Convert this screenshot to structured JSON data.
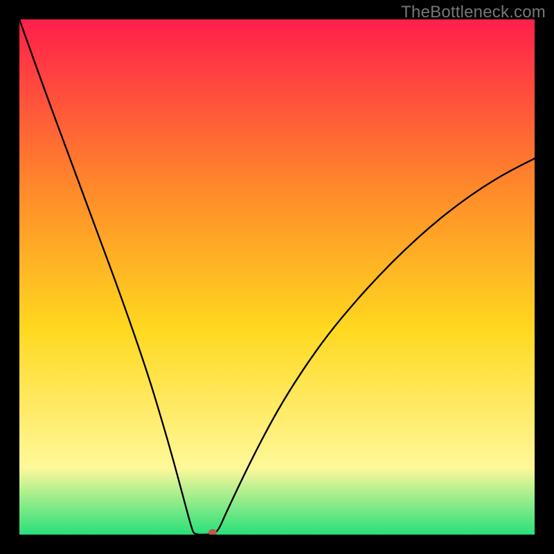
{
  "watermark": "TheBottleneck.com",
  "chart_data": {
    "type": "line",
    "title": "",
    "xlabel": "",
    "ylabel": "",
    "ylim": [
      0,
      100
    ],
    "xlim": [
      0,
      100
    ],
    "x": [
      0,
      5,
      10,
      15,
      20,
      25,
      28,
      30,
      32,
      33.5,
      34,
      37,
      38.5,
      40,
      45,
      50,
      55,
      60,
      65,
      70,
      75,
      80,
      85,
      90,
      95,
      100
    ],
    "values": [
      100,
      86,
      72.5,
      59,
      45.5,
      31,
      21,
      14,
      6.5,
      1,
      0,
      0,
      0.5,
      4,
      14.5,
      24,
      32,
      39,
      45,
      50.5,
      55.5,
      60,
      64,
      67.5,
      70.5,
      73
    ],
    "marker": {
      "x": 37.5,
      "y": 0
    },
    "colors": {
      "gradient_top": "#ff1f4b",
      "gradient_mid_upper": "#ff8a2a",
      "gradient_mid": "#ffd81f",
      "gradient_mid_lower": "#fff89a",
      "gradient_bottom": "#27e07a",
      "curve": "#000000",
      "marker": "#c5564c"
    }
  }
}
